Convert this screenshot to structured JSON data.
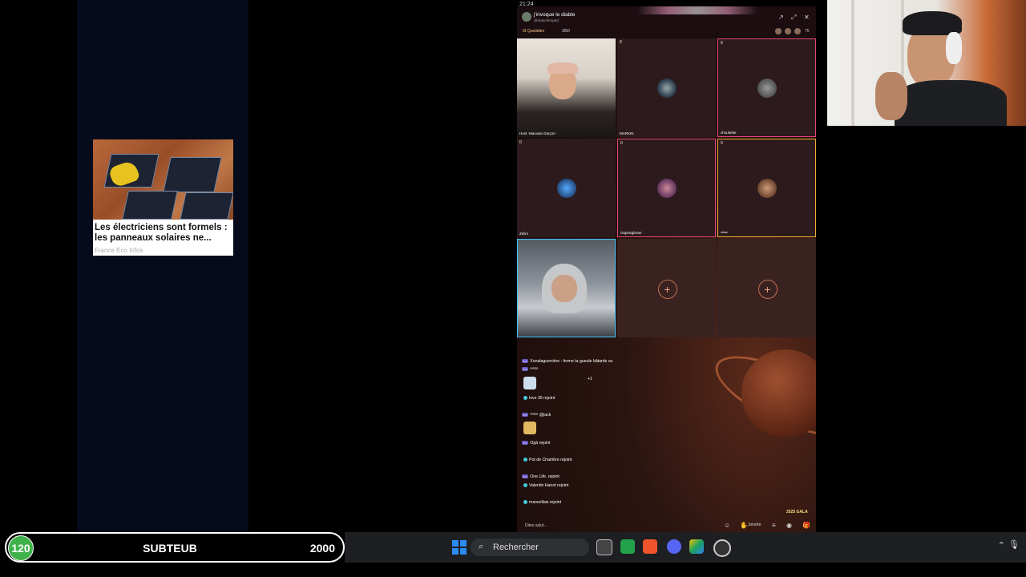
{
  "ad": {
    "title": "Les électriciens sont formels : les panneaux solaires ne...",
    "source": "France Eco Infos"
  },
  "status_bar": {
    "time": "21:24"
  },
  "room": {
    "title": "j'invoque le diable",
    "subtitle": "@mancheryard",
    "daily": "iS Quotidien",
    "count": "3/50",
    "viewers": "75"
  },
  "seats": [
    {
      "num": "",
      "name": "Host ·Mauvais Garçon·",
      "kind": "camera"
    },
    {
      "num": "0",
      "name": "MARKIN",
      "kind": "avatar"
    },
    {
      "num": "0",
      "name": "choukette",
      "kind": "avatar"
    },
    {
      "num": "0",
      "name": "Zelim",
      "kind": "avatar"
    },
    {
      "num": "0",
      "name": "OupsSglisser",
      "kind": "avatar"
    },
    {
      "num": "0",
      "name": "ᵛᵉˡᵃᶜᵉ",
      "kind": "avatar"
    },
    {
      "num": "0",
      "name": "",
      "kind": "camera"
    },
    {
      "num": "",
      "name": "",
      "kind": "empty"
    },
    {
      "num": "",
      "name": "",
      "kind": "empty"
    }
  ],
  "chat": {
    "lines": [
      "Xonalaguerrière : ferme ta gueule bâtards va",
      "ᵛᵉˡᵃᶜᵉ",
      "+1",
      "love 35 rejoint",
      "ᵛᵉˡᵃᶜᵉ @jack",
      "Ogā rejoint",
      "Pot de Chambre rejoint",
      "One Life. rejoint",
      "Valentin Hanot rejoint",
      "marseillais rejoint"
    ],
    "input_placeholder": "Dites salut...",
    "join_label": "Joindre",
    "gala_label": "2025 GALA"
  },
  "subgoal": {
    "current": "120",
    "label": "SUBTEUB",
    "target": "2000",
    "accent": "#3fb14a"
  },
  "taskbar": {
    "search_placeholder": "Rechercher"
  },
  "colors": {
    "seat_pink": "#e8457a",
    "seat_gold": "#f0b030",
    "seat_blue": "#43c6ff",
    "taskbar_bg": "#1d1f22"
  }
}
